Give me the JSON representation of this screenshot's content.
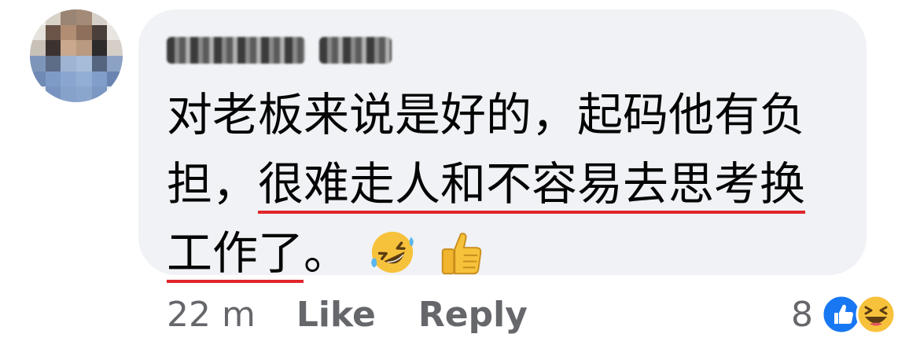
{
  "comment": {
    "author_name": "",
    "lines": [
      {
        "plain": "对老板来说是好的，起码他有负",
        "highlight": ""
      },
      {
        "plain": "担，",
        "highlight": "很难走人和不容易去思考换"
      },
      {
        "plain": "",
        "highlight": "工作了",
        "after": "。"
      }
    ],
    "emojis": [
      "rolling-on-floor-laughing",
      "thumbs-up"
    ],
    "timestamp": "22 m",
    "like_label": "Like",
    "reply_label": "Reply",
    "reaction_count": "8",
    "reaction_icons": [
      "like",
      "haha"
    ]
  },
  "colors": {
    "bubble": "#f0f2f5",
    "text": "#050505",
    "meta": "#65676b",
    "underline": "#e0262a",
    "like_blue": "#1877f2"
  }
}
